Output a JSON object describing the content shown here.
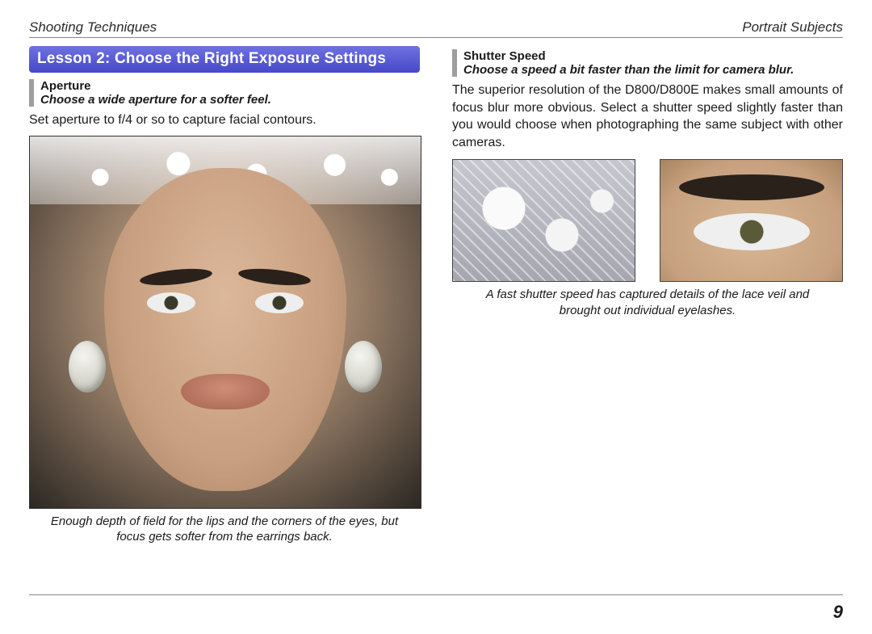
{
  "header": {
    "left": "Shooting Techniques",
    "right": "Portrait Subjects"
  },
  "lesson_banner": "Lesson 2: Choose the Right Exposure Settings",
  "left_column": {
    "section_title": "Aperture",
    "section_tagline": "Choose a wide aperture for a softer feel.",
    "body": "Set aperture to f/4 or so to capture facial contours.",
    "caption": "Enough depth of field for the lips and the corners of the eyes, but focus gets softer from the earrings back."
  },
  "right_column": {
    "section_title": "Shutter Speed",
    "section_tagline": "Choose a speed a bit faster than the limit for camera blur.",
    "body": "The superior resolution of the D800/D800E makes small amounts of focus blur more obvious. Select a shutter speed slightly faster than you would choose when photographing the same subject with other cameras.",
    "caption": "A fast shutter speed has captured details of the lace veil and brought out individual eyelashes."
  },
  "page_number": "9"
}
